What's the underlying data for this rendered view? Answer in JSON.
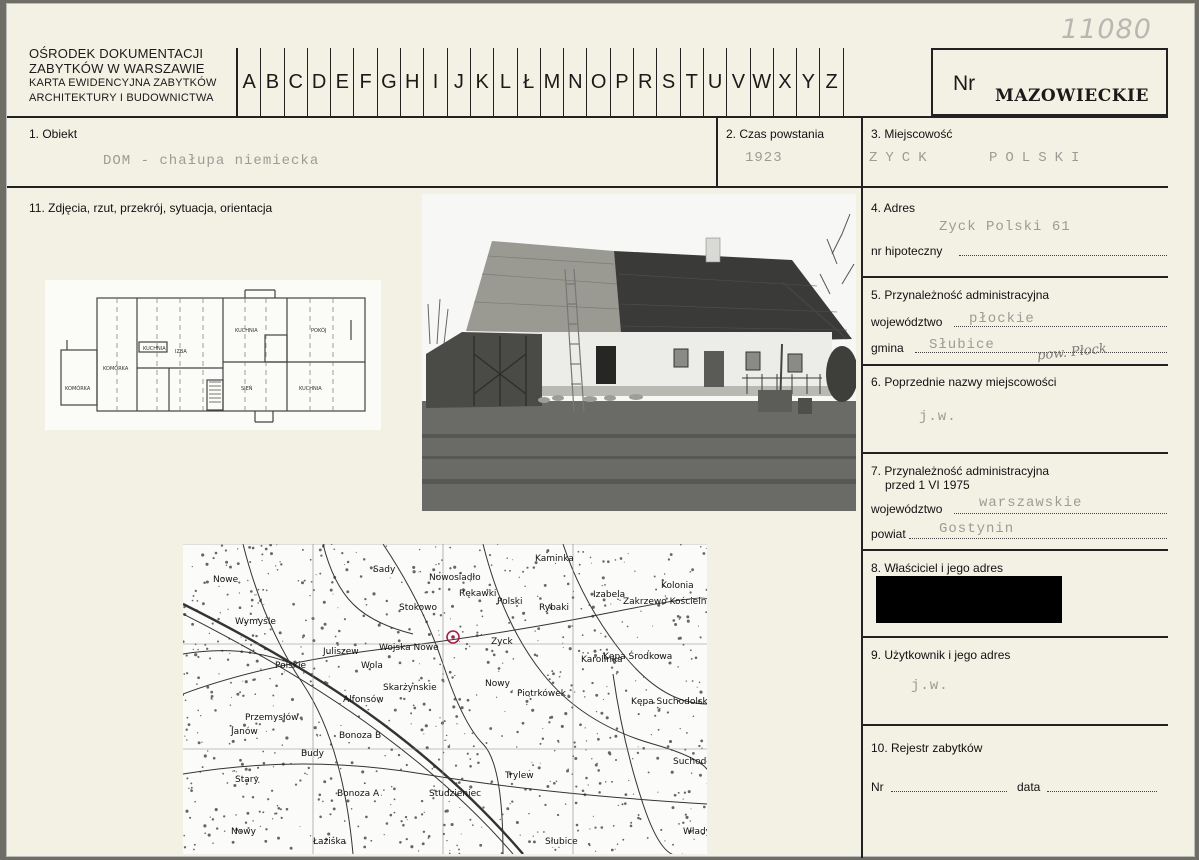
{
  "header": {
    "institution_line1": "OŚRODEK DOKUMENTACJI",
    "institution_line2": "ZABYTKÓW W WARSZAWIE",
    "institution_line3": "KARTA EWIDENCYJNA ZABYTKÓW",
    "institution_line4": "ARCHITEKTURY I BUDOWNICTWA",
    "letters": [
      "A",
      "B",
      "C",
      "D",
      "E",
      "F",
      "G",
      "H",
      "I",
      "J",
      "K",
      "L",
      "Ł",
      "M",
      "N",
      "O",
      "P",
      "R",
      "S",
      "T",
      "U",
      "V",
      "W",
      "X",
      "Y",
      "Z"
    ],
    "nr_label": "Nr",
    "region": "MAZOWIECKIE",
    "handwritten_number": "11080"
  },
  "fields": {
    "object_label": "1. Obiekt",
    "object_value": "DOM - chałupa niemiecka",
    "time_label": "2. Czas powstania",
    "time_value": "1923",
    "place_label": "3. Miejscowość",
    "place_value": "ZYCK POLSKI",
    "photos_label": "11. Zdjęcia, rzut, przekrój, sytuacja, orientacja",
    "address_label": "4. Adres",
    "address_value": "Zyck Polski 61",
    "mortgage_label": "nr hipoteczny",
    "admin_label": "5. Przynależność administracyjna",
    "voivodeship_label": "województwo",
    "voivodeship_value": "płockie",
    "commune_label": "gmina",
    "commune_value": "Słubice",
    "commune_note": "pow. Płock",
    "prev_names_label": "6. Poprzednie nazwy miejscowości",
    "prev_names_value": "j.w.",
    "admin_old_label_1": "7. Przynależność administracyjna",
    "admin_old_label_2": "przed 1 VI 1975",
    "voivodeship_old_label": "województwo",
    "voivodeship_old_value": "warszawskie",
    "district_label": "powiat",
    "district_value": "Gostynin",
    "owner_label": "8. Właściciel i jego adres",
    "user_label": "9. Użytkownik i jego adres",
    "user_value": "j.w.",
    "register_label": "10. Rejestr zabytków",
    "nr_label": "Nr",
    "date_label": "data"
  },
  "plan_labels": [
    "KOMÓRKA",
    "KOMÓRKA",
    "SIEŃ",
    "IZBA",
    "KUCHNIA",
    "KUCHNIA",
    "POKÓJ",
    "KUCHNIA"
  ],
  "map_labels": [
    "Nowe",
    "Sady",
    "Nowosiadło",
    "Kaminka",
    "Rękawki",
    "Polski",
    "Rybaki",
    "Izabela",
    "Zakrzewo Kościelne",
    "Kolonia",
    "Wymyśle",
    "Stokowo",
    "Juliszew",
    "Wojska Nowe",
    "Zyck",
    "Kępa Środkowa",
    "Karolinka",
    "Polskie",
    "Wola",
    "Skarżynskie",
    "Nowy",
    "Piotrkówek",
    "Alfonsów",
    "Kępa Suchodolska",
    "Przemysłów",
    "Janów",
    "Bonoza B",
    "Budy",
    "Trylew",
    "Studzieniec",
    "Stary",
    "Bonoza A",
    "Suchodół",
    "Nowy",
    "Łaziska",
    "Słubice",
    "Władysławów"
  ]
}
